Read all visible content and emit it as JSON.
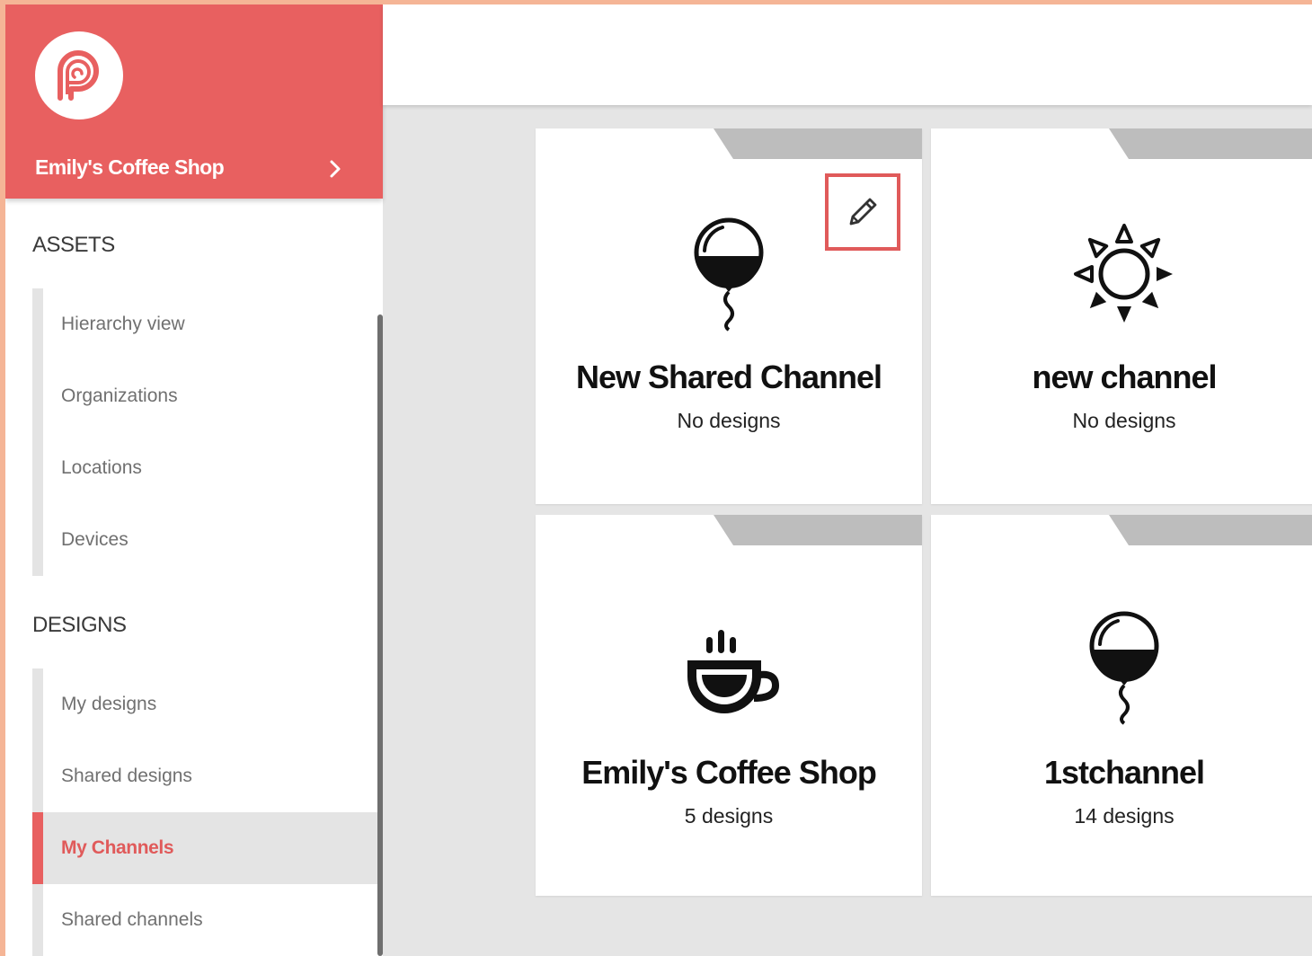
{
  "org": {
    "name": "Emily's Coffee Shop"
  },
  "sections": {
    "assets": {
      "title": "ASSETS",
      "items": [
        {
          "label": "Hierarchy view"
        },
        {
          "label": "Organizations"
        },
        {
          "label": "Locations"
        },
        {
          "label": "Devices"
        }
      ]
    },
    "designs": {
      "title": "DESIGNS",
      "items": [
        {
          "label": "My designs"
        },
        {
          "label": "Shared designs"
        },
        {
          "label": "My Channels",
          "active": true
        },
        {
          "label": "Shared channels"
        }
      ]
    }
  },
  "colors": {
    "brand": "#e86060",
    "active_text": "#e05a5a",
    "background": "#e5e5e5"
  },
  "channels": [
    {
      "name": "New Shared Channel",
      "designs": "No designs",
      "icon": "balloon-icon",
      "editing": true
    },
    {
      "name": "new channel",
      "designs": "No designs",
      "icon": "sun-icon"
    },
    {
      "name": "Emily's Coffee Shop",
      "designs": "5 designs",
      "icon": "coffee-cup-icon"
    },
    {
      "name": "1stchannel",
      "designs": "14 designs",
      "icon": "balloon-icon"
    }
  ]
}
